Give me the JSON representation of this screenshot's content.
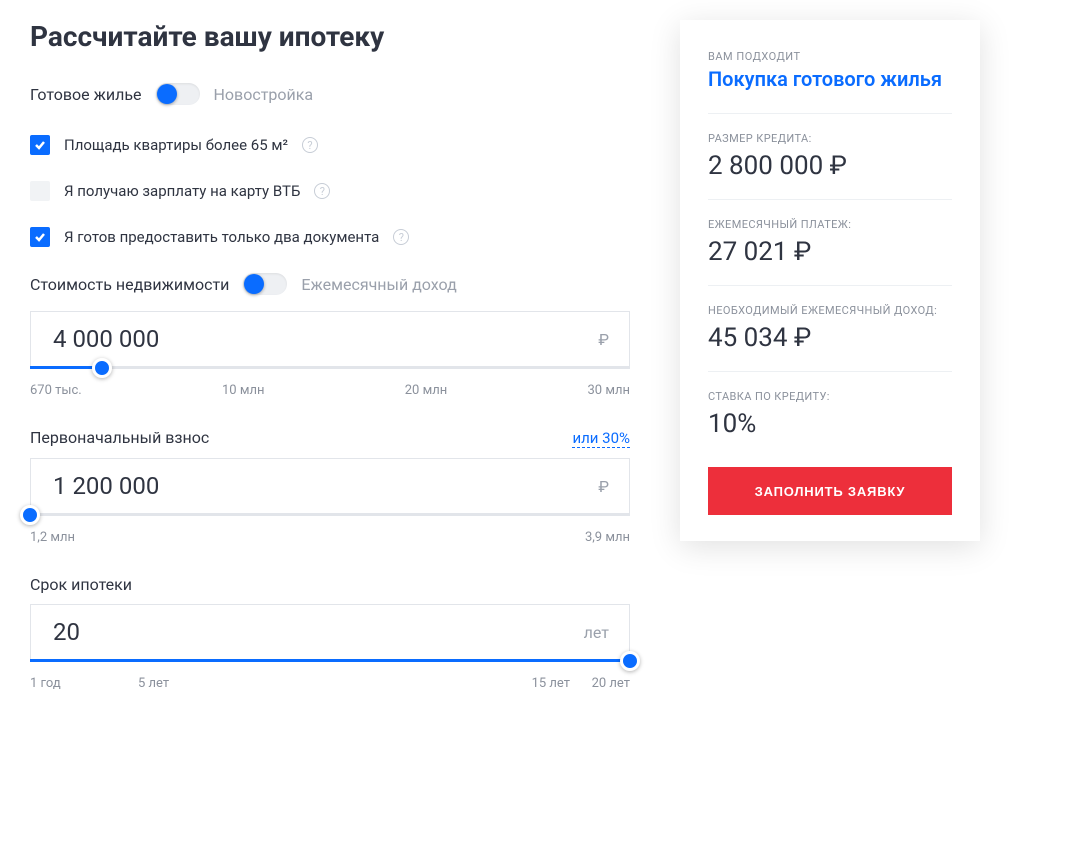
{
  "title": "Рассчитайте вашу ипотеку",
  "housing_toggle": {
    "left": "Готовое жилье",
    "right": "Новостройка"
  },
  "checks": {
    "area": "Площадь квартиры более 65 м²",
    "salary": "Я получаю зарплату на карту ВТБ",
    "two_docs": "Я готов предоставить только два документа"
  },
  "basis_toggle": {
    "left": "Стоимость недвижимости",
    "right": "Ежемесячный доход"
  },
  "price": {
    "value": "4 000 000",
    "unit": "₽",
    "labels": [
      "670 тыс.",
      "10 млн",
      "20 млн",
      "30 млн"
    ],
    "fill_pct": 12
  },
  "downpayment": {
    "title": "Первоначальный взнос",
    "link": "или 30%",
    "value": "1 200 000",
    "unit": "₽",
    "labels": [
      "1,2 млн",
      "3,9 млн"
    ],
    "fill_pct": 0
  },
  "term": {
    "title": "Срок ипотеки",
    "value": "20",
    "unit": "лет",
    "labels": [
      "1 год",
      "5 лет",
      "15 лет",
      "20 лет"
    ],
    "fill_pct": 100
  },
  "card": {
    "sub": "ВАМ ПОДХОДИТ",
    "title": "Покупка готового жилья",
    "stats": [
      {
        "label": "РАЗМЕР КРЕДИТА:",
        "value": "2 800 000 ₽"
      },
      {
        "label": "ЕЖЕМЕСЯЧНЫЙ ПЛАТЕЖ:",
        "value": "27 021 ₽"
      },
      {
        "label": "НЕОБХОДИМЫЙ ЕЖЕМЕСЯЧНЫЙ ДОХОД:",
        "value": "45 034 ₽"
      },
      {
        "label": "СТАВКА ПО КРЕДИТУ:",
        "value": "10%"
      }
    ],
    "button": "ЗАПОЛНИТЬ ЗАЯВКУ"
  }
}
